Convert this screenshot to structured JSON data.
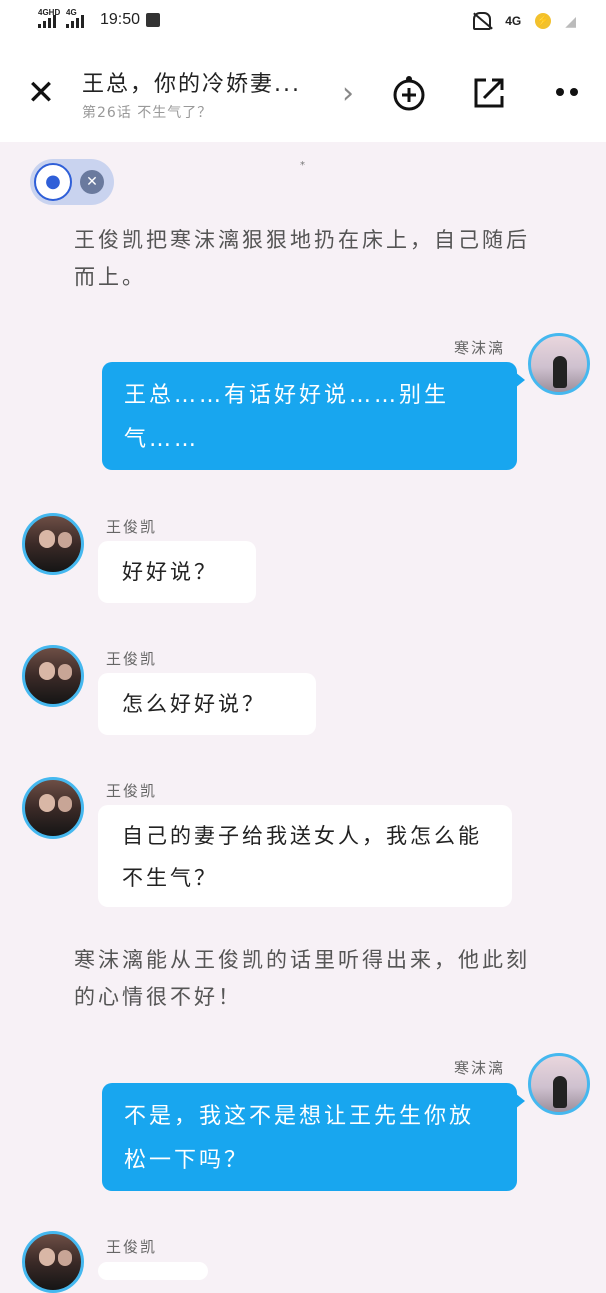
{
  "status": {
    "network1": "4GHD",
    "network2": "4G",
    "time": "19:50",
    "network_right": "4G"
  },
  "header": {
    "title": "王总，你的冷娇妻...",
    "subtitle": "第26话 不生气了？"
  },
  "messages": {
    "narr1": "王俊凯把寒沫漓狠狠地扔在床上，自己随后而上。",
    "her_name1": "寒沫漓",
    "her1": "王总……有话好好说……别生气……",
    "him_name1": "王俊凯",
    "him1": "好好说？",
    "him_name2": "王俊凯",
    "him2": "怎么好好说？",
    "him_name3": "王俊凯",
    "him3": "自己的妻子给我送女人，我怎么能不生气？",
    "narr2": "寒沫漓能从王俊凯的话里听得出来，他此刻的心情很不好！",
    "her_name2": "寒沫漓",
    "her2": "不是，我这不是想让王先生你放松一下吗？",
    "him_name4": "王俊凯"
  },
  "icons": {
    "close": "close-icon",
    "add": "add-circle-icon",
    "share": "share-icon",
    "more": "more-icon",
    "mic": "voice-icon"
  }
}
